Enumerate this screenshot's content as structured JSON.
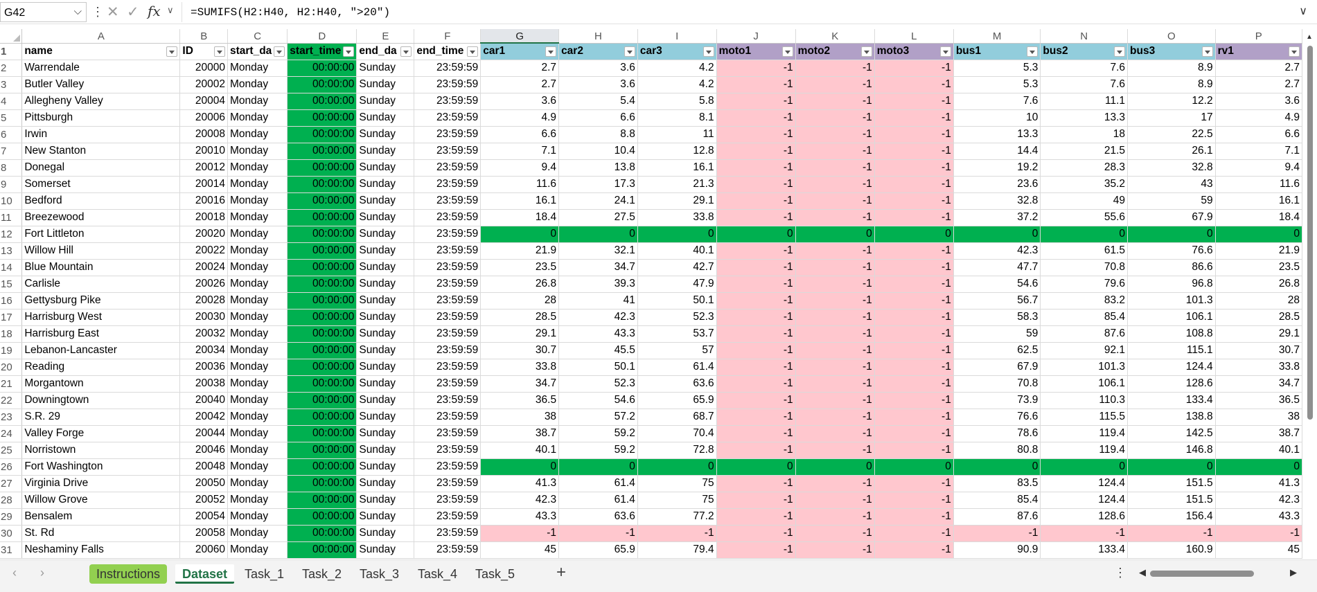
{
  "formula_bar": {
    "name_box": "G42",
    "fx_label": "fx",
    "formula": "=SUMIFS(H2:H40, H2:H40, \">20\")"
  },
  "columns": [
    "A",
    "B",
    "C",
    "D",
    "E",
    "F",
    "G",
    "H",
    "I",
    "J",
    "K",
    "L",
    "M",
    "N",
    "O",
    "P"
  ],
  "selected_column": "G",
  "header_row": [
    "name",
    "ID",
    "start_da",
    "start_time",
    "end_da",
    "end_time",
    "car1",
    "car2",
    "car3",
    "moto1",
    "moto2",
    "moto3",
    "bus1",
    "bus2",
    "bus3",
    "rv1"
  ],
  "rows": [
    {
      "n": "2",
      "name": "Warrendale",
      "id": "20000",
      "sd": "Monday",
      "st": "00:00:00",
      "ed": "Sunday",
      "et": "23:59:59",
      "v": [
        "2.7",
        "3.6",
        "4.2",
        "-1",
        "-1",
        "-1",
        "5.3",
        "7.6",
        "8.9",
        "2.7"
      ]
    },
    {
      "n": "3",
      "name": "Butler Valley",
      "id": "20002",
      "sd": "Monday",
      "st": "00:00:00",
      "ed": "Sunday",
      "et": "23:59:59",
      "v": [
        "2.7",
        "3.6",
        "4.2",
        "-1",
        "-1",
        "-1",
        "5.3",
        "7.6",
        "8.9",
        "2.7"
      ]
    },
    {
      "n": "4",
      "name": "Allegheny Valley",
      "id": "20004",
      "sd": "Monday",
      "st": "00:00:00",
      "ed": "Sunday",
      "et": "23:59:59",
      "v": [
        "3.6",
        "5.4",
        "5.8",
        "-1",
        "-1",
        "-1",
        "7.6",
        "11.1",
        "12.2",
        "3.6"
      ]
    },
    {
      "n": "5",
      "name": "Pittsburgh",
      "id": "20006",
      "sd": "Monday",
      "st": "00:00:00",
      "ed": "Sunday",
      "et": "23:59:59",
      "v": [
        "4.9",
        "6.6",
        "8.1",
        "-1",
        "-1",
        "-1",
        "10",
        "13.3",
        "17",
        "4.9"
      ]
    },
    {
      "n": "6",
      "name": "Irwin",
      "id": "20008",
      "sd": "Monday",
      "st": "00:00:00",
      "ed": "Sunday",
      "et": "23:59:59",
      "v": [
        "6.6",
        "8.8",
        "11",
        "-1",
        "-1",
        "-1",
        "13.3",
        "18",
        "22.5",
        "6.6"
      ]
    },
    {
      "n": "7",
      "name": "New Stanton",
      "id": "20010",
      "sd": "Monday",
      "st": "00:00:00",
      "ed": "Sunday",
      "et": "23:59:59",
      "v": [
        "7.1",
        "10.4",
        "12.8",
        "-1",
        "-1",
        "-1",
        "14.4",
        "21.5",
        "26.1",
        "7.1"
      ]
    },
    {
      "n": "8",
      "name": "Donegal",
      "id": "20012",
      "sd": "Monday",
      "st": "00:00:00",
      "ed": "Sunday",
      "et": "23:59:59",
      "v": [
        "9.4",
        "13.8",
        "16.1",
        "-1",
        "-1",
        "-1",
        "19.2",
        "28.3",
        "32.8",
        "9.4"
      ]
    },
    {
      "n": "9",
      "name": "Somerset",
      "id": "20014",
      "sd": "Monday",
      "st": "00:00:00",
      "ed": "Sunday",
      "et": "23:59:59",
      "v": [
        "11.6",
        "17.3",
        "21.3",
        "-1",
        "-1",
        "-1",
        "23.6",
        "35.2",
        "43",
        "11.6"
      ]
    },
    {
      "n": "10",
      "name": "Bedford",
      "id": "20016",
      "sd": "Monday",
      "st": "00:00:00",
      "ed": "Sunday",
      "et": "23:59:59",
      "v": [
        "16.1",
        "24.1",
        "29.1",
        "-1",
        "-1",
        "-1",
        "32.8",
        "49",
        "59",
        "16.1"
      ]
    },
    {
      "n": "11",
      "name": "Breezewood",
      "id": "20018",
      "sd": "Monday",
      "st": "00:00:00",
      "ed": "Sunday",
      "et": "23:59:59",
      "v": [
        "18.4",
        "27.5",
        "33.8",
        "-1",
        "-1",
        "-1",
        "37.2",
        "55.6",
        "67.9",
        "18.4"
      ]
    },
    {
      "n": "12",
      "name": "Fort Littleton",
      "id": "20020",
      "sd": "Monday",
      "st": "00:00:00",
      "ed": "Sunday",
      "et": "23:59:59",
      "v": [
        "0",
        "0",
        "0",
        "0",
        "0",
        "0",
        "0",
        "0",
        "0",
        "0"
      ],
      "zero": true
    },
    {
      "n": "13",
      "name": "Willow Hill",
      "id": "20022",
      "sd": "Monday",
      "st": "00:00:00",
      "ed": "Sunday",
      "et": "23:59:59",
      "v": [
        "21.9",
        "32.1",
        "40.1",
        "-1",
        "-1",
        "-1",
        "42.3",
        "61.5",
        "76.6",
        "21.9"
      ]
    },
    {
      "n": "14",
      "name": "Blue Mountain",
      "id": "20024",
      "sd": "Monday",
      "st": "00:00:00",
      "ed": "Sunday",
      "et": "23:59:59",
      "v": [
        "23.5",
        "34.7",
        "42.7",
        "-1",
        "-1",
        "-1",
        "47.7",
        "70.8",
        "86.6",
        "23.5"
      ]
    },
    {
      "n": "15",
      "name": "Carlisle",
      "id": "20026",
      "sd": "Monday",
      "st": "00:00:00",
      "ed": "Sunday",
      "et": "23:59:59",
      "v": [
        "26.8",
        "39.3",
        "47.9",
        "-1",
        "-1",
        "-1",
        "54.6",
        "79.6",
        "96.8",
        "26.8"
      ]
    },
    {
      "n": "16",
      "name": "Gettysburg Pike",
      "id": "20028",
      "sd": "Monday",
      "st": "00:00:00",
      "ed": "Sunday",
      "et": "23:59:59",
      "v": [
        "28",
        "41",
        "50.1",
        "-1",
        "-1",
        "-1",
        "56.7",
        "83.2",
        "101.3",
        "28"
      ]
    },
    {
      "n": "17",
      "name": "Harrisburg West",
      "id": "20030",
      "sd": "Monday",
      "st": "00:00:00",
      "ed": "Sunday",
      "et": "23:59:59",
      "v": [
        "28.5",
        "42.3",
        "52.3",
        "-1",
        "-1",
        "-1",
        "58.3",
        "85.4",
        "106.1",
        "28.5"
      ]
    },
    {
      "n": "18",
      "name": "Harrisburg East",
      "id": "20032",
      "sd": "Monday",
      "st": "00:00:00",
      "ed": "Sunday",
      "et": "23:59:59",
      "v": [
        "29.1",
        "43.3",
        "53.7",
        "-1",
        "-1",
        "-1",
        "59",
        "87.6",
        "108.8",
        "29.1"
      ]
    },
    {
      "n": "19",
      "name": "Lebanon-Lancaster",
      "id": "20034",
      "sd": "Monday",
      "st": "00:00:00",
      "ed": "Sunday",
      "et": "23:59:59",
      "v": [
        "30.7",
        "45.5",
        "57",
        "-1",
        "-1",
        "-1",
        "62.5",
        "92.1",
        "115.1",
        "30.7"
      ]
    },
    {
      "n": "20",
      "name": "Reading",
      "id": "20036",
      "sd": "Monday",
      "st": "00:00:00",
      "ed": "Sunday",
      "et": "23:59:59",
      "v": [
        "33.8",
        "50.1",
        "61.4",
        "-1",
        "-1",
        "-1",
        "67.9",
        "101.3",
        "124.4",
        "33.8"
      ]
    },
    {
      "n": "21",
      "name": "Morgantown",
      "id": "20038",
      "sd": "Monday",
      "st": "00:00:00",
      "ed": "Sunday",
      "et": "23:59:59",
      "v": [
        "34.7",
        "52.3",
        "63.6",
        "-1",
        "-1",
        "-1",
        "70.8",
        "106.1",
        "128.6",
        "34.7"
      ]
    },
    {
      "n": "22",
      "name": "Downingtown",
      "id": "20040",
      "sd": "Monday",
      "st": "00:00:00",
      "ed": "Sunday",
      "et": "23:59:59",
      "v": [
        "36.5",
        "54.6",
        "65.9",
        "-1",
        "-1",
        "-1",
        "73.9",
        "110.3",
        "133.4",
        "36.5"
      ]
    },
    {
      "n": "23",
      "name": "S.R. 29",
      "id": "20042",
      "sd": "Monday",
      "st": "00:00:00",
      "ed": "Sunday",
      "et": "23:59:59",
      "v": [
        "38",
        "57.2",
        "68.7",
        "-1",
        "-1",
        "-1",
        "76.6",
        "115.5",
        "138.8",
        "38"
      ]
    },
    {
      "n": "24",
      "name": "Valley Forge",
      "id": "20044",
      "sd": "Monday",
      "st": "00:00:00",
      "ed": "Sunday",
      "et": "23:59:59",
      "v": [
        "38.7",
        "59.2",
        "70.4",
        "-1",
        "-1",
        "-1",
        "78.6",
        "119.4",
        "142.5",
        "38.7"
      ]
    },
    {
      "n": "25",
      "name": "Norristown",
      "id": "20046",
      "sd": "Monday",
      "st": "00:00:00",
      "ed": "Sunday",
      "et": "23:59:59",
      "v": [
        "40.1",
        "59.2",
        "72.8",
        "-1",
        "-1",
        "-1",
        "80.8",
        "119.4",
        "146.8",
        "40.1"
      ]
    },
    {
      "n": "26",
      "name": "Fort Washington",
      "id": "20048",
      "sd": "Monday",
      "st": "00:00:00",
      "ed": "Sunday",
      "et": "23:59:59",
      "v": [
        "0",
        "0",
        "0",
        "0",
        "0",
        "0",
        "0",
        "0",
        "0",
        "0"
      ],
      "zero": true
    },
    {
      "n": "27",
      "name": "Virginia Drive",
      "id": "20050",
      "sd": "Monday",
      "st": "00:00:00",
      "ed": "Sunday",
      "et": "23:59:59",
      "v": [
        "41.3",
        "61.4",
        "75",
        "-1",
        "-1",
        "-1",
        "83.5",
        "124.4",
        "151.5",
        "41.3"
      ]
    },
    {
      "n": "28",
      "name": "Willow Grove",
      "id": "20052",
      "sd": "Monday",
      "st": "00:00:00",
      "ed": "Sunday",
      "et": "23:59:59",
      "v": [
        "42.3",
        "61.4",
        "75",
        "-1",
        "-1",
        "-1",
        "85.4",
        "124.4",
        "151.5",
        "42.3"
      ]
    },
    {
      "n": "29",
      "name": "Bensalem",
      "id": "20054",
      "sd": "Monday",
      "st": "00:00:00",
      "ed": "Sunday",
      "et": "23:59:59",
      "v": [
        "43.3",
        "63.6",
        "77.2",
        "-1",
        "-1",
        "-1",
        "87.6",
        "128.6",
        "156.4",
        "43.3"
      ]
    },
    {
      "n": "30",
      "name": "St. Rd",
      "id": "20058",
      "sd": "Monday",
      "st": "00:00:00",
      "ed": "Sunday",
      "et": "23:59:59",
      "v": [
        "-1",
        "-1",
        "-1",
        "-1",
        "-1",
        "-1",
        "-1",
        "-1",
        "-1",
        "-1"
      ],
      "allneg": true
    },
    {
      "n": "31",
      "name": "Neshaminy Falls",
      "id": "20060",
      "sd": "Monday",
      "st": "00:00:00",
      "ed": "Sunday",
      "et": "23:59:59",
      "v": [
        "45",
        "65.9",
        "79.4",
        "-1",
        "-1",
        "-1",
        "90.9",
        "133.4",
        "160.9",
        "45"
      ]
    }
  ],
  "sheet_tabs": [
    "Instructions",
    "Dataset",
    "Task_1",
    "Task_2",
    "Task_3",
    "Task_4",
    "Task_5"
  ],
  "active_tab": "Dataset",
  "colors": {
    "green": "#00b050",
    "pink": "#ffc7ce",
    "blue_header": "#92cddc",
    "purple_header": "#b1a0c7",
    "instructions_tab": "#92d050",
    "accent": "#217346"
  }
}
